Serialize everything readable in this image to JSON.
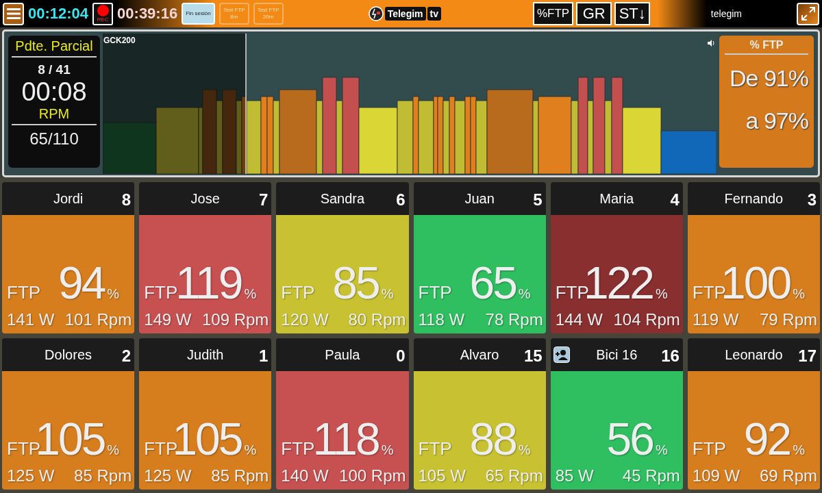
{
  "top_bar": {
    "session_time": "00:12:04",
    "rec_label": "REC",
    "total_time": "00:39:16",
    "buttons": [
      {
        "label": "Fin sesión",
        "selected": true
      },
      {
        "label": "Test FTP\n8m",
        "selected": false
      },
      {
        "label": "Test FTP\n20m",
        "selected": false
      }
    ],
    "logo": {
      "name": "Telegim",
      "suffix": "tv"
    },
    "mode_buttons": [
      "%FTP",
      "GR",
      "ST↓"
    ],
    "user": "telegim"
  },
  "workout": {
    "title": "GCK200",
    "info": {
      "heading": "Pdte. Parcial",
      "progress": "8 / 41",
      "time": "00:08",
      "rpm_label": "RPM",
      "rpm_range": "65/110"
    },
    "target": {
      "heading": "% FTP",
      "from": "De 91%",
      "to": "a 97%"
    }
  },
  "riders": [
    {
      "kind": "rider",
      "name": "Jordi",
      "number": "8",
      "color": "#d67d1e",
      "label": "FTP",
      "percent": "94",
      "unit": "%",
      "watts": "141 W",
      "rpm": "101 Rpm"
    },
    {
      "kind": "rider",
      "name": "Jose",
      "number": "7",
      "color": "#c75050",
      "label": "FTP",
      "percent": "119",
      "unit": "%",
      "watts": "149 W",
      "rpm": "109 Rpm"
    },
    {
      "kind": "rider",
      "name": "Sandra",
      "number": "6",
      "color": "#c8c232",
      "label": "FTP",
      "percent": "85",
      "unit": "%",
      "watts": "120 W",
      "rpm": "80 Rpm"
    },
    {
      "kind": "rider",
      "name": "Juan",
      "number": "5",
      "color": "#2fbf60",
      "label": "FTP",
      "percent": "65",
      "unit": "%",
      "watts": "118 W",
      "rpm": "78 Rpm"
    },
    {
      "kind": "rider",
      "name": "Maria",
      "number": "4",
      "color": "#8a2f2f",
      "label": "FTP",
      "percent": "122",
      "unit": "%",
      "watts": "144 W",
      "rpm": "104 Rpm"
    },
    {
      "kind": "rider",
      "name": "Fernando",
      "number": "3",
      "color": "#d67d1e",
      "label": "FTP",
      "percent": "100",
      "unit": "%",
      "watts": "119 W",
      "rpm": "79 Rpm"
    },
    {
      "kind": "rider",
      "name": "Dolores",
      "number": "2",
      "color": "#d67d1e",
      "label": "FTP",
      "percent": "105",
      "unit": "%",
      "watts": "125 W",
      "rpm": "85 Rpm"
    },
    {
      "kind": "rider",
      "name": "Judith",
      "number": "1",
      "color": "#d67d1e",
      "label": "FTP",
      "percent": "105",
      "unit": "%",
      "watts": "125 W",
      "rpm": "85 Rpm"
    },
    {
      "kind": "rider",
      "name": "Paula",
      "number": "0",
      "color": "#c75050",
      "label": "FTP",
      "percent": "118",
      "unit": "%",
      "watts": "140 W",
      "rpm": "100 Rpm"
    },
    {
      "kind": "rider",
      "name": "Alvaro",
      "number": "15",
      "color": "#c8c232",
      "label": "FTP",
      "percent": "88",
      "unit": "%",
      "watts": "105 W",
      "rpm": "65 Rpm"
    },
    {
      "kind": "unassigned",
      "name": "Bici 16",
      "number": "16",
      "color": "#2fbf60",
      "percent": "56",
      "unit": "%",
      "watts": "85 W",
      "rpm": "45 Rpm"
    },
    {
      "kind": "rider",
      "name": "Leonardo",
      "number": "17",
      "color": "#d67d1e",
      "label": "FTP",
      "percent": "92",
      "unit": "%",
      "watts": "109 W",
      "rpm": "69 Rpm"
    }
  ]
}
